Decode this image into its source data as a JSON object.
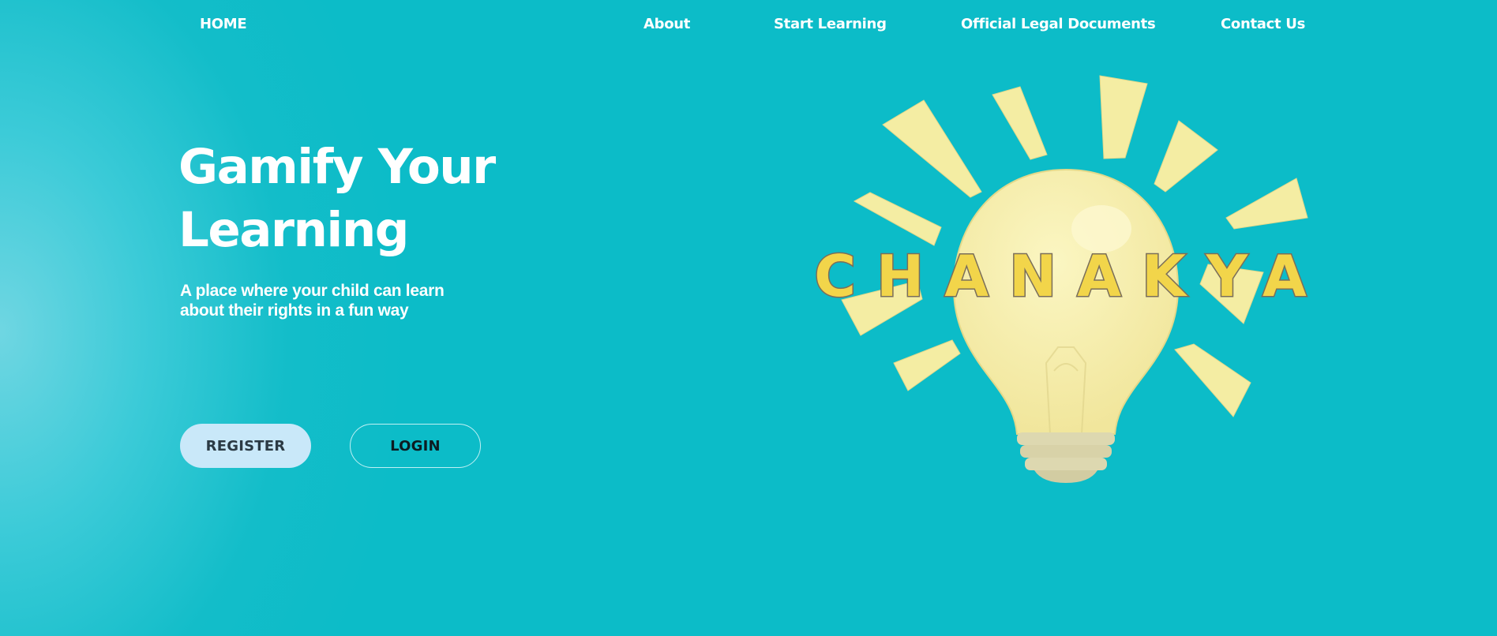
{
  "nav": {
    "home": "HOME",
    "about": "About",
    "start_learning": "Start Learning",
    "legal_documents": "Official Legal Documents",
    "contact": "Contact Us"
  },
  "hero": {
    "title": "Gamify Your Learning",
    "subtitle": "A place where your child can learn about their rights in a fun way",
    "register_label": "REGISTER",
    "login_label": "LOGIN"
  },
  "logo": {
    "wordmark": "CHANAKYA",
    "icon": "lightbulb-icon"
  },
  "colors": {
    "background": "#0cbcc8",
    "register_button": "#c9e8f9",
    "bulb": "#f6efa6",
    "wordmark": "#f2d54a"
  }
}
